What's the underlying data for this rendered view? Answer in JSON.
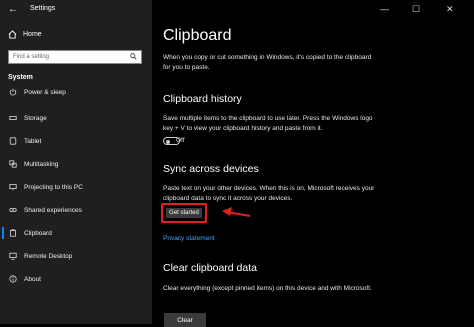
{
  "titlebar": {
    "back_glyph": "←",
    "title": "Settings",
    "minimize_glyph": "—",
    "restore_glyph": "☐",
    "close_glyph": "✕"
  },
  "sidebar": {
    "home_label": "Home",
    "search_placeholder": "Find a setting",
    "section_title": "System",
    "items": [
      {
        "label": "Power & sleep",
        "icon": "power-icon"
      },
      {
        "label": "Storage",
        "icon": "storage-icon"
      },
      {
        "label": "Tablet",
        "icon": "tablet-icon"
      },
      {
        "label": "Multitasking",
        "icon": "multitasking-icon"
      },
      {
        "label": "Projecting to this PC",
        "icon": "projecting-icon"
      },
      {
        "label": "Shared experiences",
        "icon": "shared-experiences-icon"
      },
      {
        "label": "Clipboard",
        "icon": "clipboard-icon",
        "active": true
      },
      {
        "label": "Remote Desktop",
        "icon": "remote-desktop-icon"
      },
      {
        "label": "About",
        "icon": "about-icon"
      }
    ]
  },
  "main": {
    "title": "Clipboard",
    "intro": "When you copy or cut something in Windows, it's copied to the clipboard for you to paste.",
    "history": {
      "heading": "Clipboard history",
      "desc": "Save multiple items to the clipboard to use later. Press the Windows logo key + V to view your clipboard history and paste from it.",
      "toggle_state": "Off"
    },
    "sync": {
      "heading": "Sync across devices",
      "desc": "Paste text on your other devices. When this is on, Microsoft receives your clipboard data to sync it across your devices.",
      "button": "Get started",
      "link": "Privacy statement"
    },
    "clear": {
      "heading": "Clear clipboard data",
      "desc": "Clear everything (except pinned items) on this device and with Microsoft.",
      "button": "Clear"
    }
  },
  "colors": {
    "accent": "#0a84ff",
    "highlight": "#e02020",
    "link": "#4aa3ff"
  }
}
